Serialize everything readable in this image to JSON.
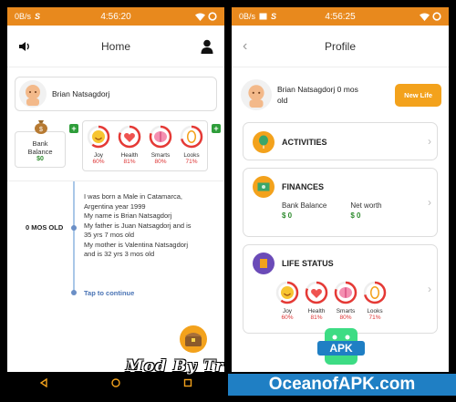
{
  "left_phone": {
    "status": {
      "speed": "0B/s",
      "brand_glyph": "S",
      "time": "4:56:20"
    },
    "appbar": {
      "title": "Home",
      "left_icon": "speaker-icon",
      "right_icon": "person-icon"
    },
    "profile": {
      "name": "Brian Natsagdorj"
    },
    "bank": {
      "label_line1": "Bank",
      "label_line2": "Balance",
      "value": "$0",
      "plus": "+"
    },
    "stats": {
      "plus": "+",
      "items": [
        {
          "label": "Joy",
          "pct": "60%",
          "value": 0.6,
          "icon": "smile-icon"
        },
        {
          "label": "Health",
          "pct": "81%",
          "value": 0.81,
          "icon": "heart-icon"
        },
        {
          "label": "Smarts",
          "pct": "80%",
          "value": 0.8,
          "icon": "brain-icon"
        },
        {
          "label": "Looks",
          "pct": "71%",
          "value": 0.71,
          "icon": "mirror-icon"
        }
      ]
    },
    "timeline": {
      "age": "0 MOS OLD",
      "lines": [
        "I was born a Male in Catamarca,",
        "Argentina year 1999",
        "My name is Brian Natsagdorj",
        "My father is Juan Natsagdorj and is",
        "35 yrs 7 mos old",
        "My mother is Valentina Natsagdorj",
        "and is 32 yrs 3 mos old"
      ],
      "tap": "Tap to continue"
    }
  },
  "right_phone": {
    "status": {
      "speed": "0B/s",
      "brand_glyph": "S",
      "time": "4:56:25"
    },
    "appbar": {
      "title": "Profile",
      "left_icon": "back-icon"
    },
    "profile": {
      "name_line1": "Brian Natsagdorj 0 mos",
      "name_line2": "old",
      "new_life": "New Life"
    },
    "activities": {
      "title": "ACTIVITIES"
    },
    "finances": {
      "title": "FINANCES",
      "bank_label": "Bank Balance",
      "bank_value": "$ 0",
      "net_label": "Net worth",
      "net_value": "$ 0"
    },
    "life_status": {
      "title": "LIFE STATUS",
      "items": [
        {
          "label": "Joy",
          "pct": "60%",
          "value": 0.6
        },
        {
          "label": "Health",
          "pct": "81%",
          "value": 0.81
        },
        {
          "label": "Smarts",
          "pct": "80%",
          "value": 0.8
        },
        {
          "label": "Looks",
          "pct": "71%",
          "value": 0.71
        }
      ]
    }
  },
  "watermark": {
    "mod": "Mod By Tr",
    "site": "OceanofAPK.com",
    "apk": "APK"
  },
  "colors": {
    "statusbar": "#e8891d",
    "accent": "#f3a21c",
    "ring": "#e53935",
    "money": "#2e8b2e"
  }
}
